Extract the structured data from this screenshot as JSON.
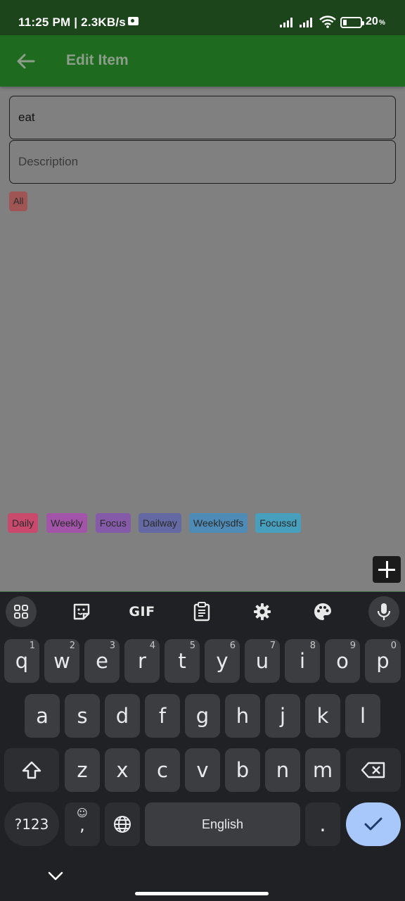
{
  "status_bar": {
    "time": "11:25 PM | 2.3KB/s",
    "battery": "20"
  },
  "app_bar": {
    "title": "Edit Item"
  },
  "form": {
    "name_value": "eat",
    "description_placeholder": "Description",
    "selected_tag": "All"
  },
  "tags": [
    {
      "label": "Daily",
      "color": "#c94a6c"
    },
    {
      "label": "Weekly",
      "color": "#a254a8"
    },
    {
      "label": "Focus",
      "color": "#855aa8"
    },
    {
      "label": "Dailway",
      "color": "#6469a3"
    },
    {
      "label": "Weeklysdfs",
      "color": "#4e8bb6"
    },
    {
      "label": "Focussd",
      "color": "#469fbd"
    }
  ],
  "keyboard": {
    "toolbar": [
      "apps-icon",
      "sticker-icon",
      "GIF",
      "clipboard-icon",
      "settings-icon",
      "palette-icon",
      "mic-icon"
    ],
    "gif_label": "GIF",
    "row1": [
      {
        "key": "q",
        "hint": "1"
      },
      {
        "key": "w",
        "hint": "2"
      },
      {
        "key": "e",
        "hint": "3"
      },
      {
        "key": "r",
        "hint": "4"
      },
      {
        "key": "t",
        "hint": "5"
      },
      {
        "key": "y",
        "hint": "6"
      },
      {
        "key": "u",
        "hint": "7"
      },
      {
        "key": "i",
        "hint": "8"
      },
      {
        "key": "o",
        "hint": "9"
      },
      {
        "key": "p",
        "hint": "0"
      }
    ],
    "row2": [
      "a",
      "s",
      "d",
      "f",
      "g",
      "h",
      "j",
      "k",
      "l"
    ],
    "row3": [
      "z",
      "x",
      "c",
      "v",
      "b",
      "n",
      "m"
    ],
    "symbols_label": "?123",
    "emoji_comma": ",",
    "space_label": "English",
    "period_label": ".",
    "colors": {
      "key": "#3c3d40",
      "enter": "#a8c7fa",
      "background": "#202124"
    }
  }
}
